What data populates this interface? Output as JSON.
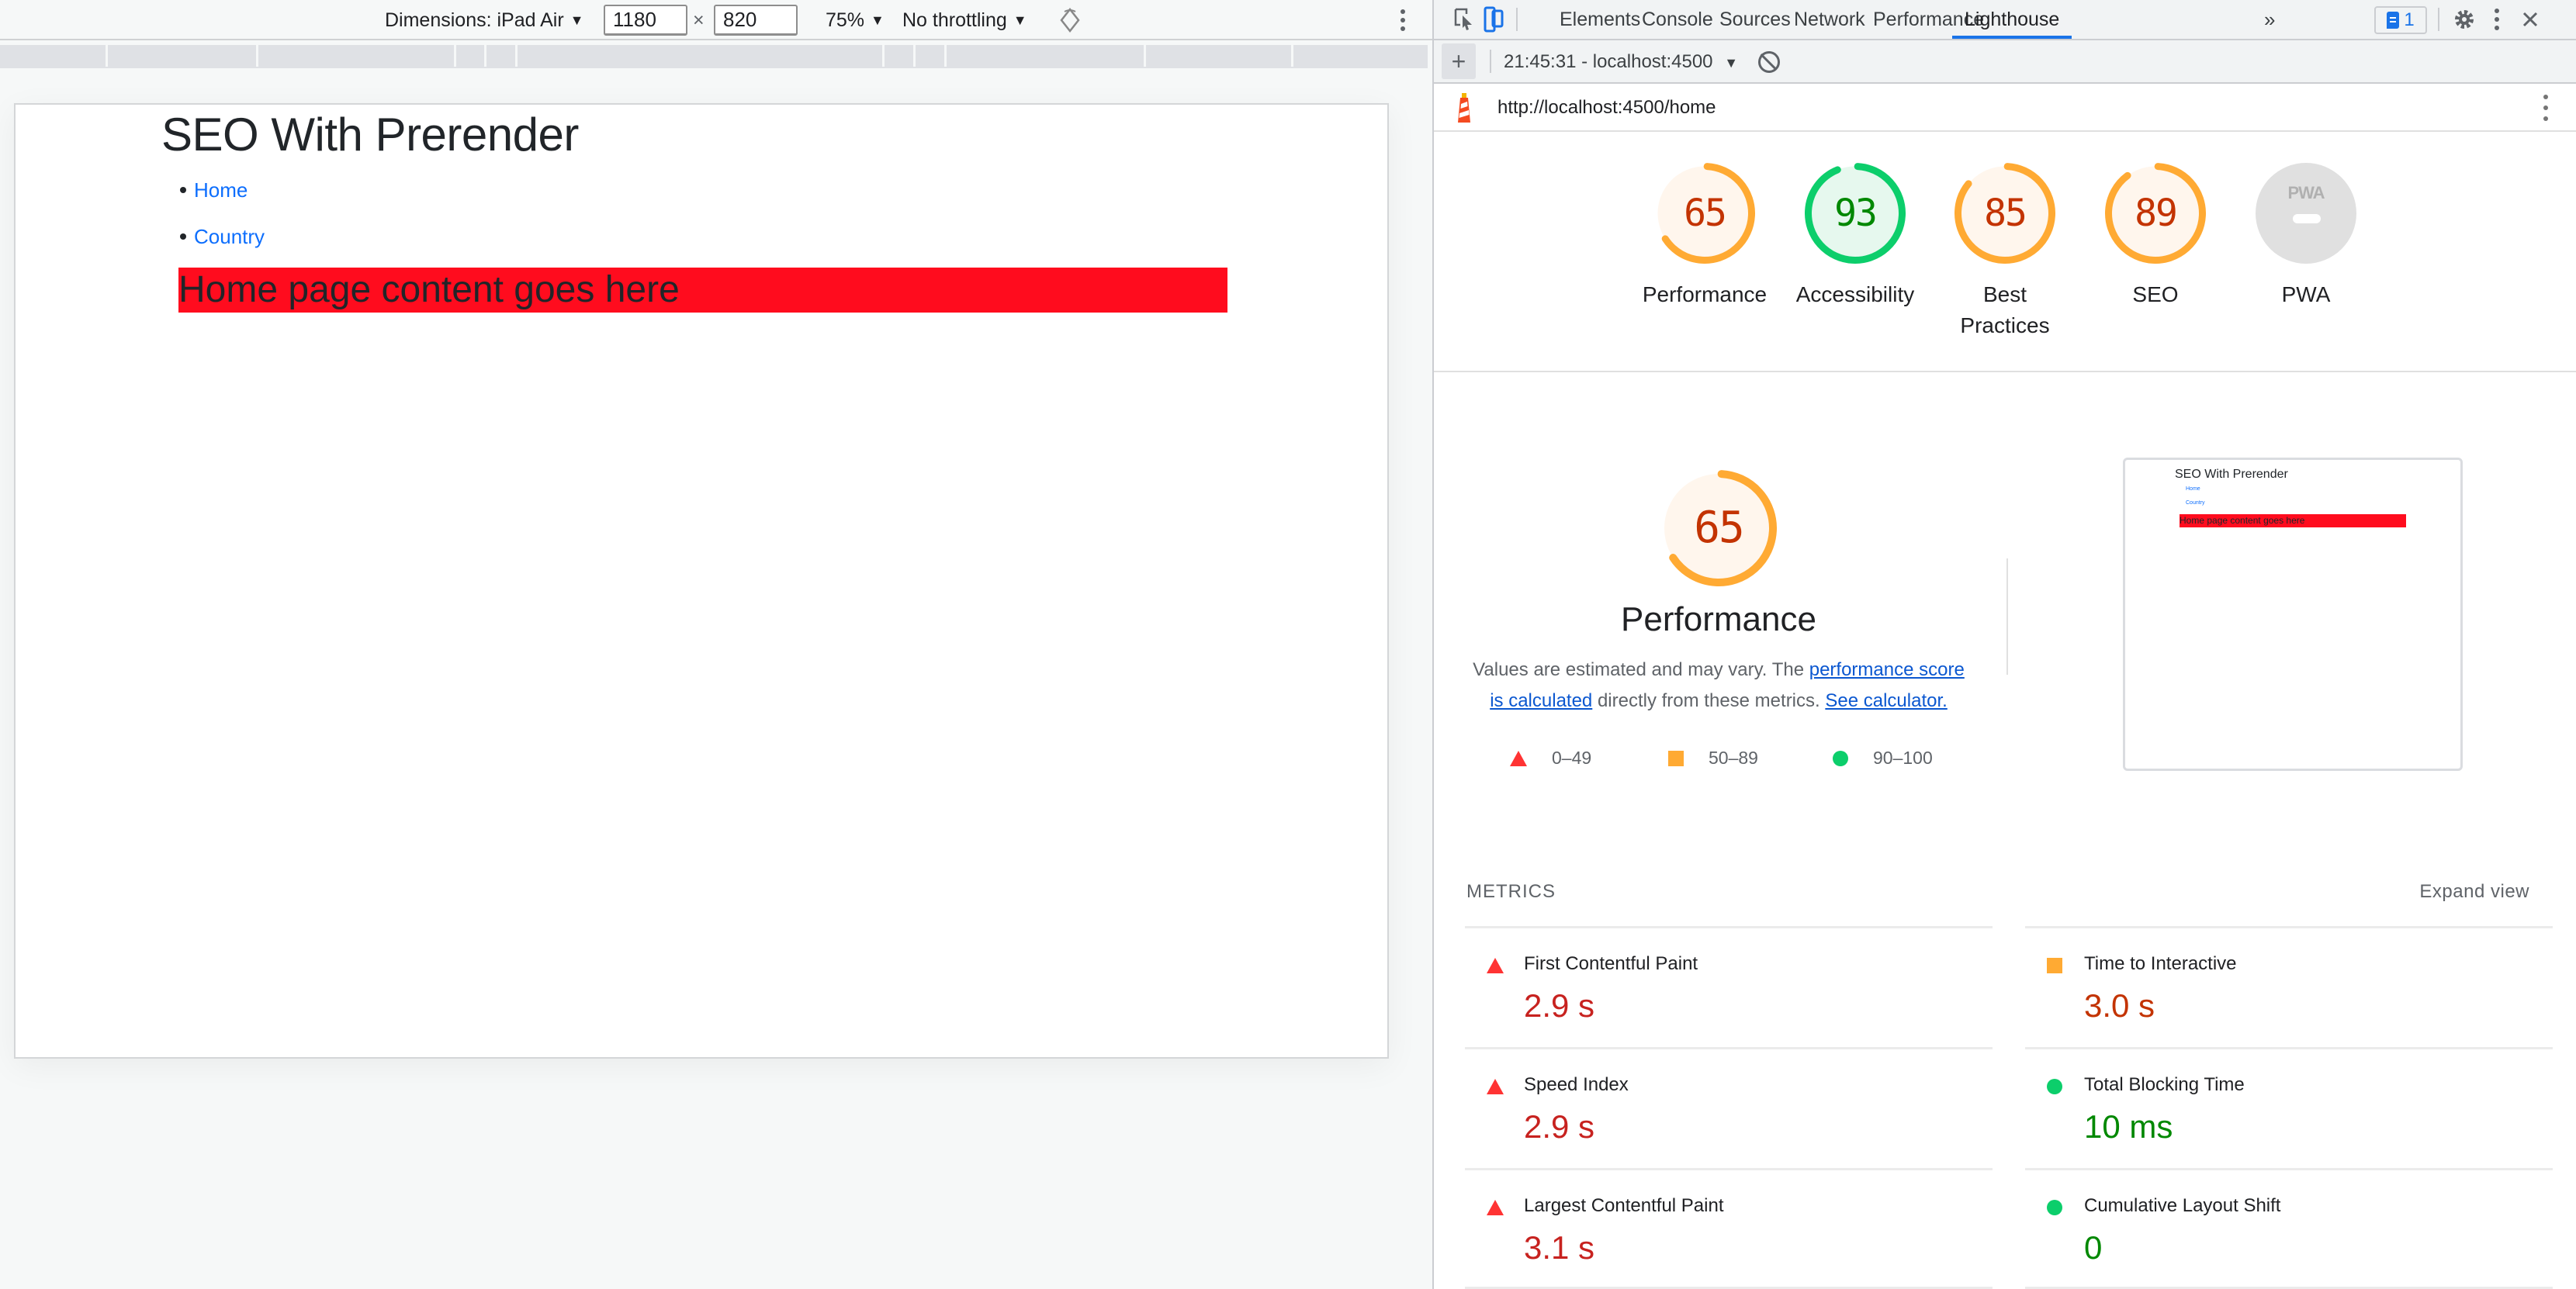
{
  "device_toolbar": {
    "dimensions_label": "Dimensions: iPad Air",
    "width_value": "1180",
    "times": "×",
    "height_value": "820",
    "zoom": "75%",
    "throttling": "No throttling"
  },
  "page": {
    "title": "SEO With Prerender",
    "nav": [
      {
        "label": "Home"
      },
      {
        "label": "Country"
      }
    ],
    "banner": "Home page content goes here"
  },
  "devtools": {
    "tabs": [
      {
        "label": "Elements"
      },
      {
        "label": "Console"
      },
      {
        "label": "Sources"
      },
      {
        "label": "Network"
      },
      {
        "label": "Performance"
      },
      {
        "label": "Lighthouse",
        "active": true
      }
    ],
    "more_tabs": "»",
    "issues_count": "1",
    "report_selector": "21:45:31 - localhost:4500",
    "report_url": "http://localhost:4500/home"
  },
  "scores": [
    {
      "label": "Performance",
      "value": 65,
      "rating": "average"
    },
    {
      "label": "Accessibility",
      "value": 93,
      "rating": "pass"
    },
    {
      "label": "Best Practices",
      "value": 85,
      "rating": "average"
    },
    {
      "label": "SEO",
      "value": 89,
      "rating": "average"
    },
    {
      "label": "PWA",
      "value": null,
      "rating": "na",
      "badge": "PWA"
    }
  ],
  "colors": {
    "fail": "#ff3333",
    "fail_text": "#c7221f",
    "average": "#ffa400",
    "average_arc": "#ffaa33",
    "average_bg": "#fff6ed",
    "average_text": "#c33300",
    "pass": "#0cce6b",
    "pass_bg": "#e6f8ee",
    "pass_text": "#008800",
    "na": "#e0e0e0",
    "link": "#0b57d0",
    "accent": "#1a73e8"
  },
  "performance": {
    "score": 65,
    "title": "Performance",
    "desc_prefix": "Values are estimated and may vary. The ",
    "desc_link1": "performance score is calculated",
    "desc_middle": " directly from these metrics. ",
    "desc_link2": "See calculator.",
    "legend": [
      {
        "shape": "triangle",
        "range": "0–49"
      },
      {
        "shape": "square",
        "range": "50–89"
      },
      {
        "shape": "circle",
        "range": "90–100"
      }
    ],
    "thumbnail": {
      "title": "SEO With Prerender",
      "nav": [
        "Home",
        "Country"
      ],
      "banner": "Home page content goes here"
    }
  },
  "metrics": {
    "title": "METRICS",
    "expand_label": "Expand view",
    "items": [
      {
        "name": "First Contentful Paint",
        "value": "2.9 s",
        "rating": "fail"
      },
      {
        "name": "Time to Interactive",
        "value": "3.0 s",
        "rating": "average"
      },
      {
        "name": "Speed Index",
        "value": "2.9 s",
        "rating": "fail"
      },
      {
        "name": "Total Blocking Time",
        "value": "10 ms",
        "rating": "pass"
      },
      {
        "name": "Largest Contentful Paint",
        "value": "3.1 s",
        "rating": "fail"
      },
      {
        "name": "Cumulative Layout Shift",
        "value": "0",
        "rating": "pass"
      }
    ]
  }
}
